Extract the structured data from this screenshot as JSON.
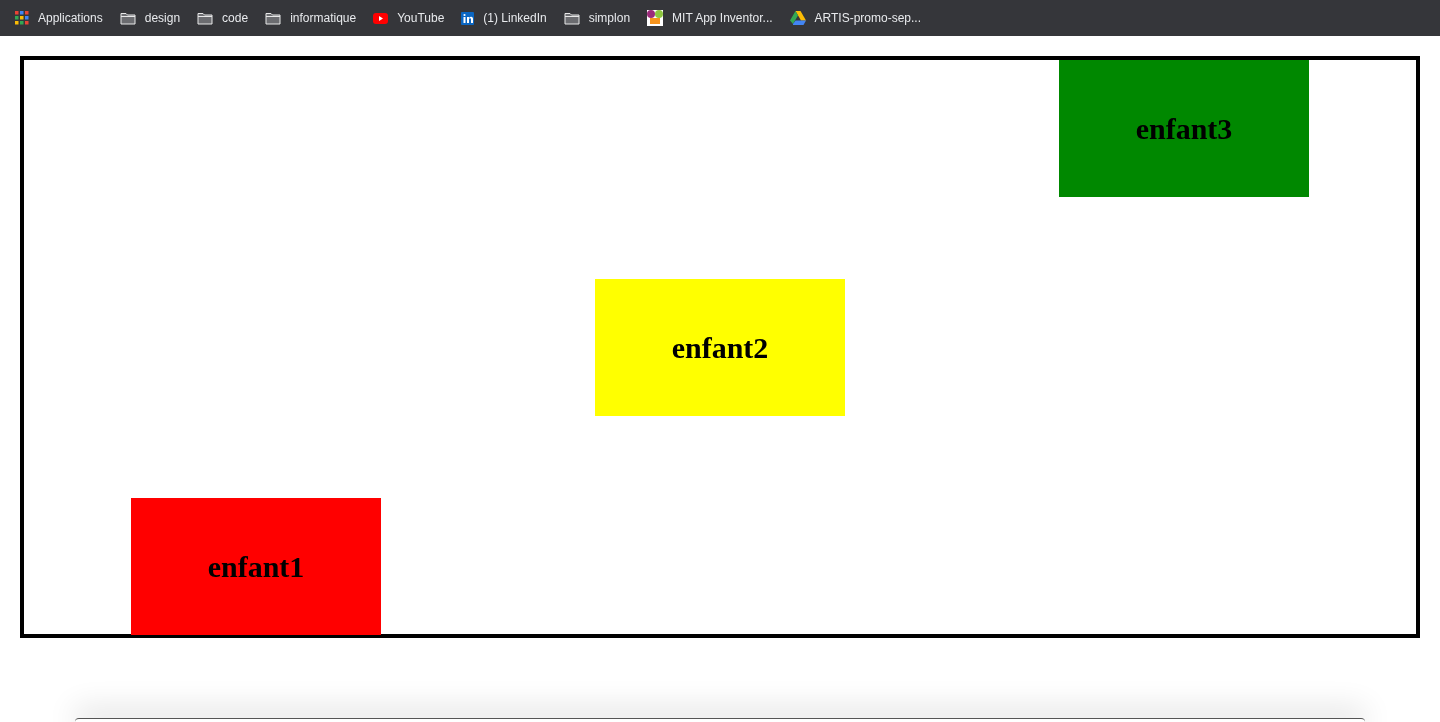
{
  "bookmarks": [
    {
      "kind": "apps",
      "label": "Applications"
    },
    {
      "kind": "folder",
      "label": "design"
    },
    {
      "kind": "folder",
      "label": "code"
    },
    {
      "kind": "folder",
      "label": "informatique"
    },
    {
      "kind": "youtube",
      "label": "YouTube"
    },
    {
      "kind": "linkedin",
      "label": "(1) LinkedIn"
    },
    {
      "kind": "folder",
      "label": "simplon"
    },
    {
      "kind": "mit",
      "label": "MIT App Inventor..."
    },
    {
      "kind": "drive",
      "label": "ARTIS-promo-sep..."
    }
  ],
  "boxes": [
    {
      "label": "enfant1",
      "color": "#ff0000"
    },
    {
      "label": "enfant2",
      "color": "#ffff00"
    },
    {
      "label": "enfant3",
      "color": "#008800"
    }
  ]
}
